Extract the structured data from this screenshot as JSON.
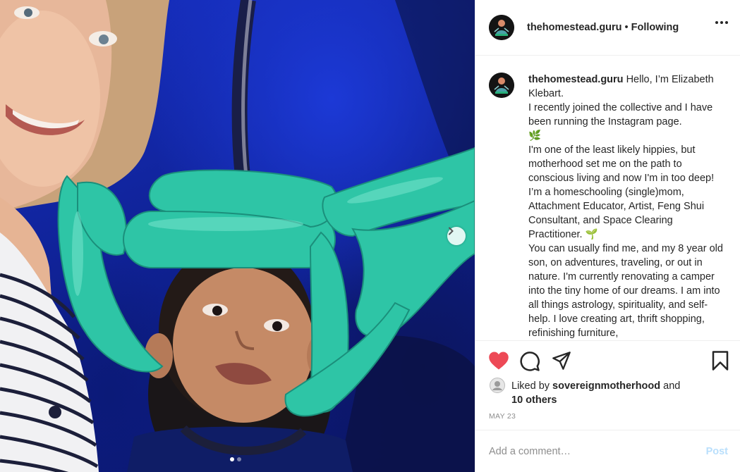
{
  "post": {
    "username": "thehomestead.guru",
    "follow_status": "Following",
    "separator": "•",
    "caption_lines": [
      "Hello, I’m Elizabeth Klebart.",
      "I recently joined the collective and I have been running the Instagram page.",
      "🌿",
      "I'm one of the least likely hippies, but motherhood set me on the path to conscious living and now I'm in too deep! I’m a homeschooling (single)mom, Attachment Educator, Artist, Feng Shui Consultant, and Space Clearing Practitioner. 🌱",
      "You can usually find me, and my 8 year old son, on adventures, traveling, or out in nature. I'm currently renovating a camper into the tiny home of our dreams. I am into all things astrology, spirituality, and self-help.  I love creating art, thrift shopping, refinishing furniture,"
    ],
    "liked_prefix": "Liked by",
    "liked_by_user": "sovereignmotherhood",
    "liked_and": "and",
    "liked_others": "10 others",
    "date": "MAY 23",
    "liked": true,
    "carousel": {
      "slides": 2,
      "current": 1
    }
  },
  "comment": {
    "placeholder": "Add a comment…",
    "post_label": "Post"
  },
  "colors": {
    "heart": "#ed4956",
    "post_disabled": "#b9dffc",
    "muted": "#8e8e8e"
  },
  "icons": {
    "like": "heart-icon",
    "comment": "comment-icon",
    "share": "paper-plane-icon",
    "save": "bookmark-icon",
    "more": "more-dots-icon",
    "next": "chevron-right-icon"
  }
}
